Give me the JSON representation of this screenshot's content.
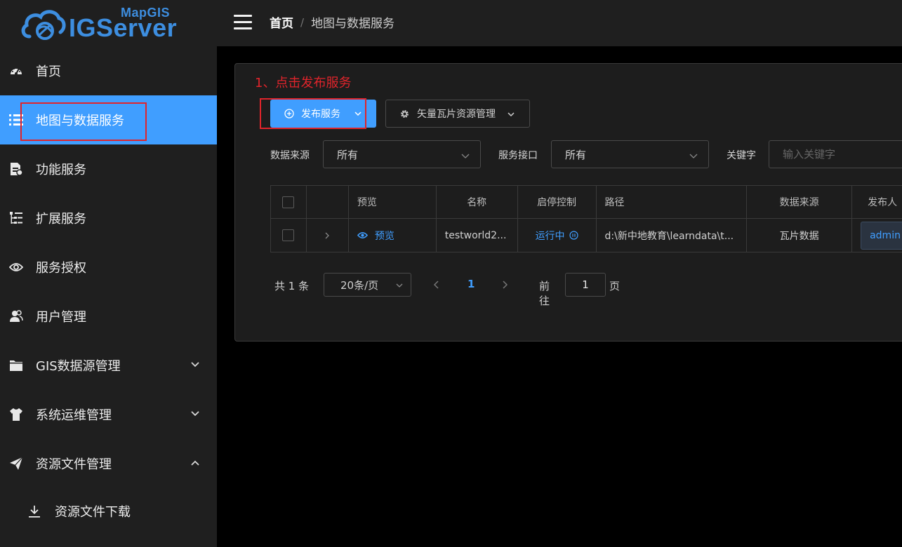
{
  "app": {
    "logo_small": "MapGIS",
    "logo_big": "IGServer",
    "brand_color": "#3d8ee0",
    "accent_color": "#409eff",
    "annotation_color": "#e0242b"
  },
  "sidebar": {
    "items": [
      {
        "label": "首页",
        "icon": "dashboard-icon"
      },
      {
        "label": "地图与数据服务",
        "icon": "list-icon",
        "active": true
      },
      {
        "label": "功能服务",
        "icon": "document-icon"
      },
      {
        "label": "扩展服务",
        "icon": "tree-icon"
      },
      {
        "label": "服务授权",
        "icon": "eye-icon"
      },
      {
        "label": "用户管理",
        "icon": "users-icon"
      },
      {
        "label": "GIS数据源管理",
        "icon": "folder-icon",
        "arrow": "down"
      },
      {
        "label": "系统运维管理",
        "icon": "shirt-icon",
        "arrow": "down"
      },
      {
        "label": "资源文件管理",
        "icon": "send-icon",
        "arrow": "up"
      },
      {
        "label": "资源文件下载",
        "icon": "download-icon",
        "sub": true
      }
    ]
  },
  "header": {
    "breadcrumb_home": "首页",
    "breadcrumb_sep": "/",
    "breadcrumb_current": "地图与数据服务"
  },
  "main": {
    "annotation": "1、点击发布服务",
    "publish_button": "发布服务",
    "tile_button": "矢量瓦片资源管理",
    "filters": {
      "source_label": "数据来源",
      "source_value": "所有",
      "interface_label": "服务接口",
      "interface_value": "所有",
      "keyword_label": "关键字",
      "keyword_placeholder": "输入关键字"
    },
    "table": {
      "headers": {
        "preview": "预览",
        "name": "名称",
        "control": "启停控制",
        "path": "路径",
        "source": "数据来源",
        "publisher": "发布人"
      },
      "rows": [
        {
          "preview": "预览",
          "name": "testworld2...",
          "status": "运行中",
          "path": "d:\\新中地教育\\learndata\\t...",
          "source": "瓦片数据",
          "publisher": "admin"
        }
      ]
    },
    "pagination": {
      "total": "共 1 条",
      "page_size": "20条/页",
      "current_page": "1",
      "goto_label": "前往",
      "goto_value": "1",
      "page_suffix": "页"
    }
  }
}
